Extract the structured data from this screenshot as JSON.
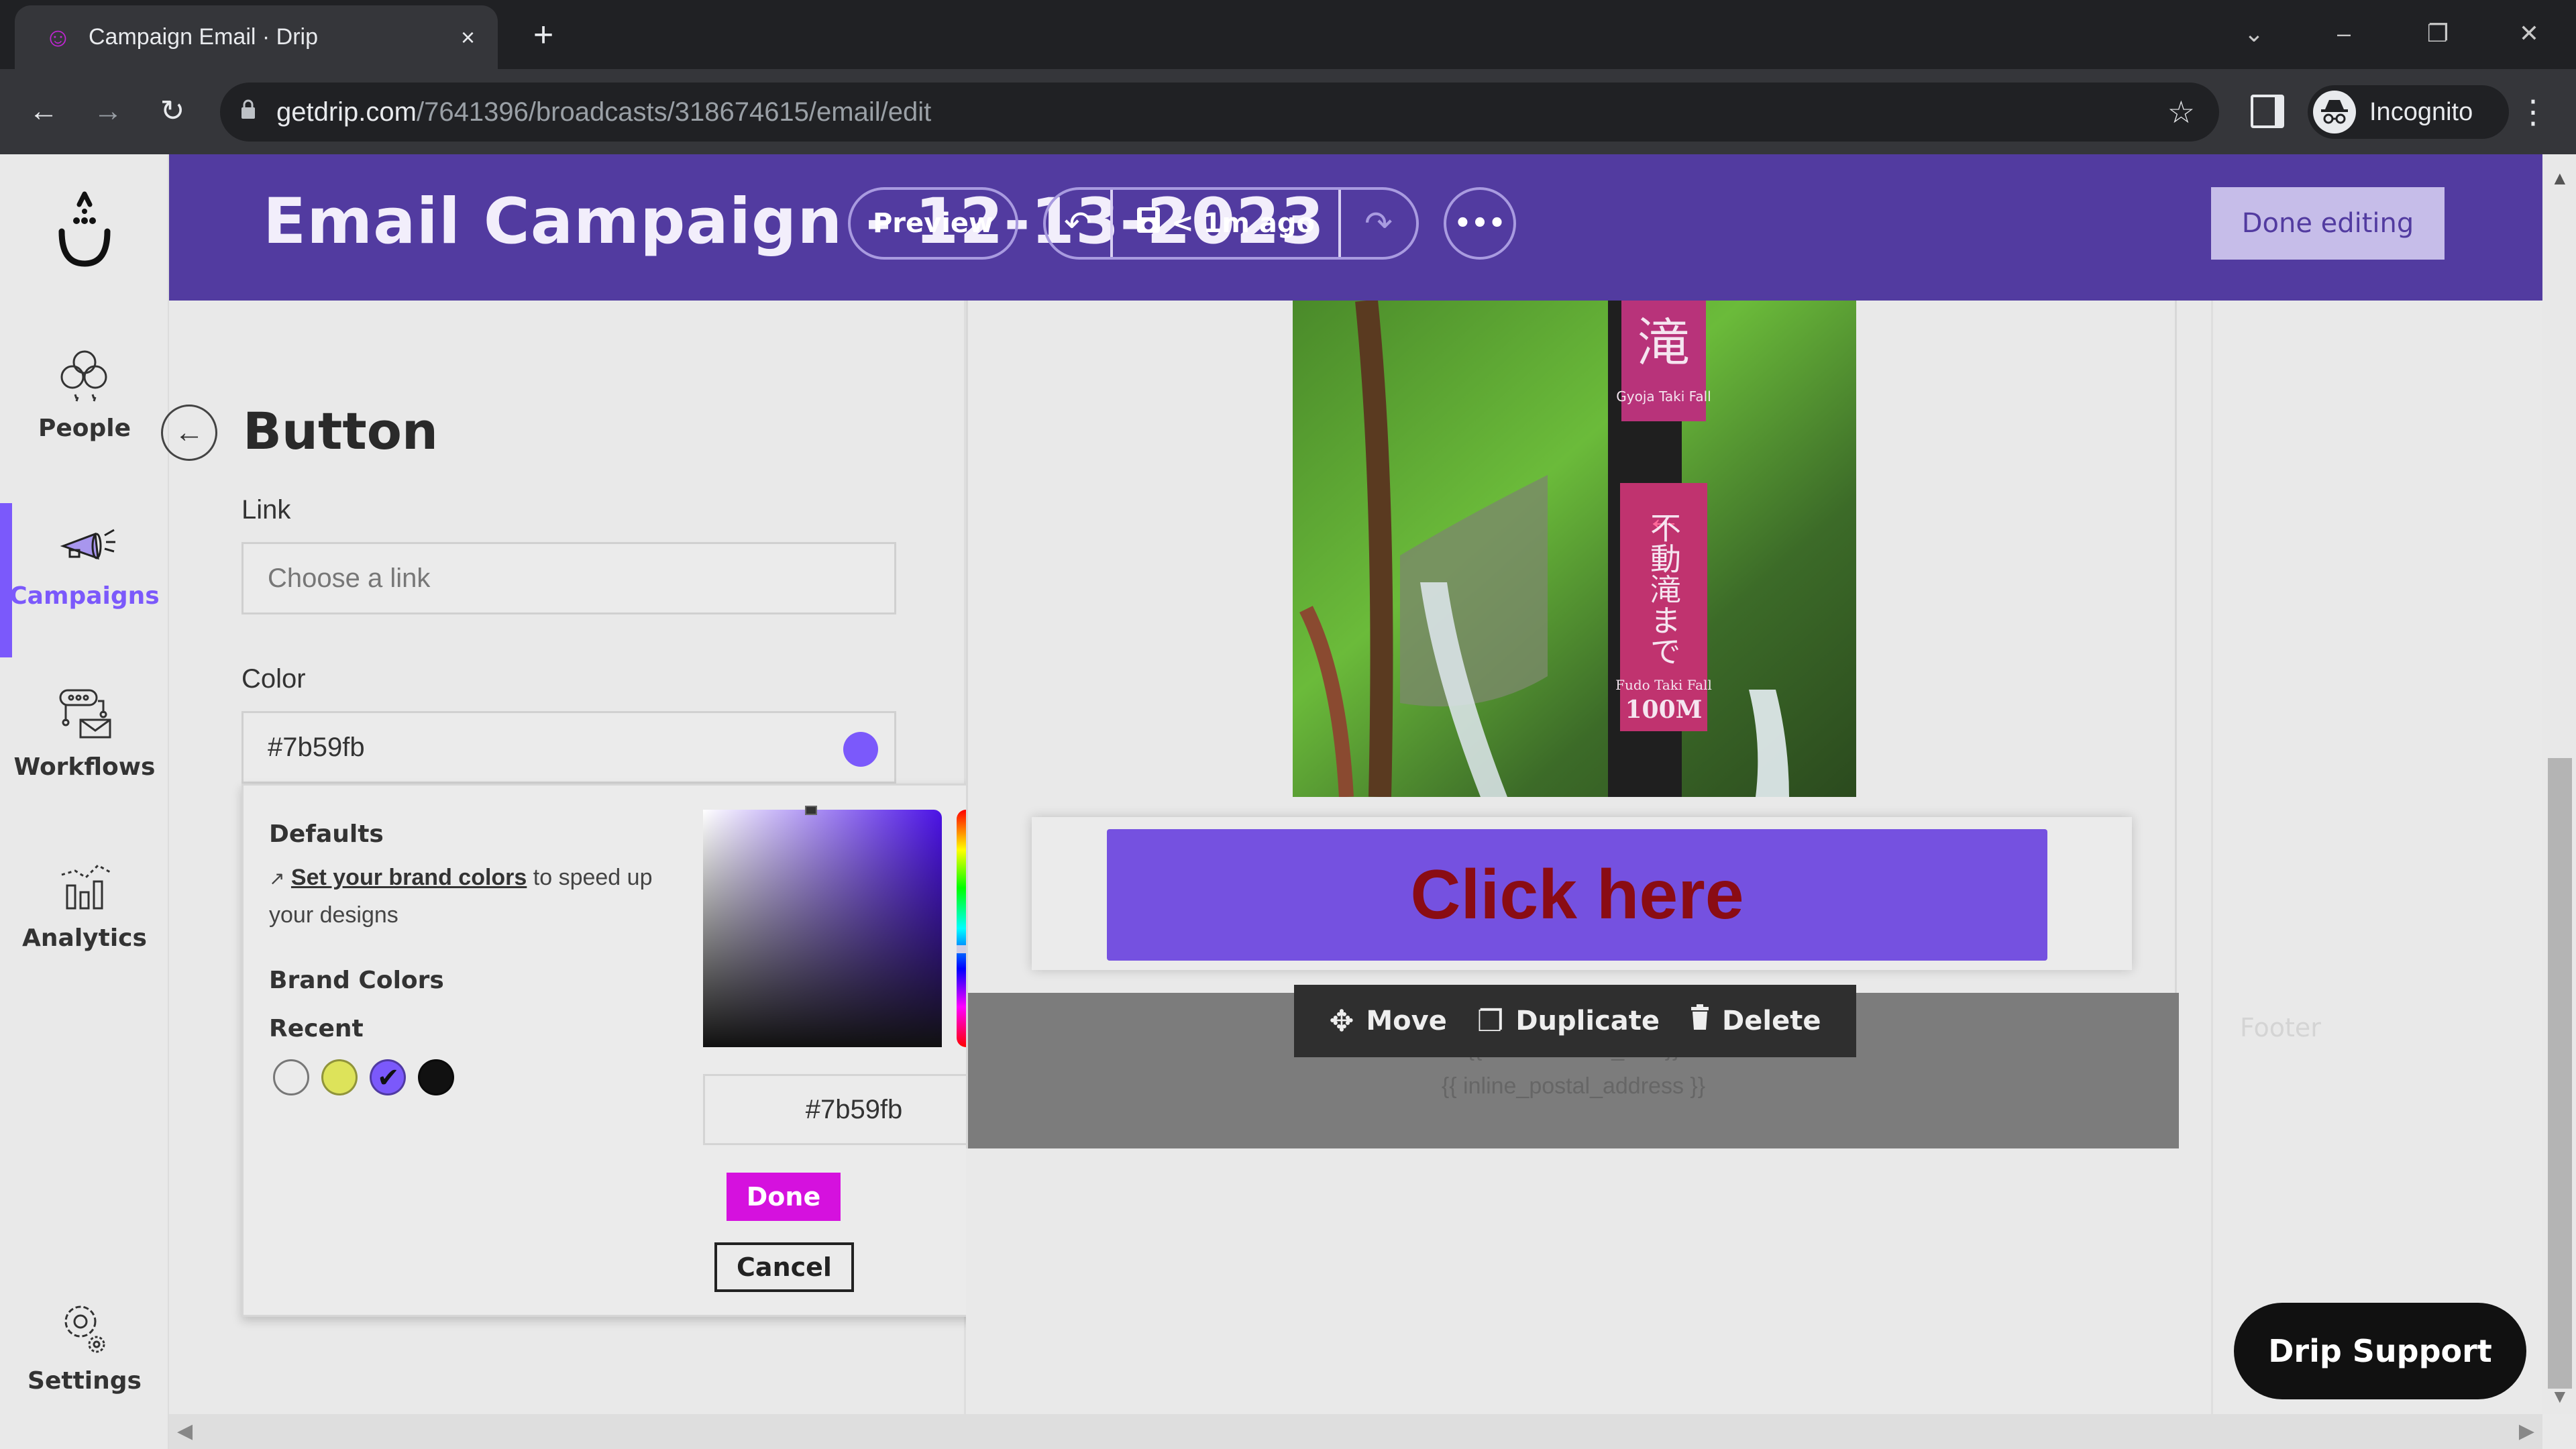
{
  "browser": {
    "tab_title": "Campaign Email · Drip",
    "tab_close": "×",
    "new_tab": "+",
    "url_host": "getdrip.com",
    "url_path": "/7641396/broadcasts/318674615/email/edit",
    "profile_label": "Incognito",
    "icons": {
      "back": "←",
      "forward": "→",
      "reload": "↻",
      "lock": "🔒",
      "star": "☆",
      "menu": "⋮",
      "tab_list": "⌄",
      "minimize": "–",
      "restore": "❐",
      "close": "✕",
      "incognito": "🕶"
    }
  },
  "sidebar": {
    "items": [
      {
        "label": "People",
        "icon": "people-icon",
        "active": false
      },
      {
        "label": "Campaigns",
        "icon": "megaphone-icon",
        "active": true
      },
      {
        "label": "Workflows",
        "icon": "workflow-icon",
        "active": false
      },
      {
        "label": "Analytics",
        "icon": "analytics-icon",
        "active": false
      },
      {
        "label": "Settings",
        "icon": "gear-icon",
        "active": false
      }
    ]
  },
  "header": {
    "title": "Email Campaign - 12-13-2023",
    "preview_label": "Preview",
    "undo_icon": "↶",
    "save_icon": "💾",
    "saved_status": "< 1m ago",
    "redo_icon": "↷",
    "more_icon": "•••",
    "done_editing_label": "Done editing"
  },
  "panel": {
    "back_icon": "←",
    "title": "Button",
    "link_label": "Link",
    "link_placeholder": "Choose a link",
    "link_value": "",
    "color_label": "Color",
    "color_value": "#7b59fb"
  },
  "color_picker": {
    "defaults_heading": "Defaults",
    "external_icon": "↗",
    "brand_link_text": "Set your brand colors",
    "brand_link_suffix": " to speed up your designs",
    "brand_colors_heading": "Brand Colors",
    "recent_heading": "Recent",
    "recent_colors": [
      {
        "hex": "#ebebeb",
        "selected": false
      },
      {
        "hex": "#dde35a",
        "selected": false
      },
      {
        "hex": "#7b59fb",
        "selected": true
      },
      {
        "hex": "#111111",
        "selected": false
      }
    ],
    "hex_value": "#7b59fb",
    "hue_color": "#4b12e6",
    "done_label": "Done",
    "cancel_label": "Cancel"
  },
  "email": {
    "cta_label": "Click here",
    "cta_bg": "#7551e0",
    "cta_text_color": "#8a0c14",
    "unsubscribe_tag": "{{ unsubscribe_link }}",
    "postal_tag": "{{ inline_postal_address }}",
    "image_sign_top": "滝",
    "image_sign_top_en": "Gyoja Taki Fall",
    "image_sign_bottom": "不動滝まで",
    "image_sign_bottom_en": "Fudo Taki Fall",
    "image_sign_distance": "100M",
    "toolbar": {
      "move_label": "Move",
      "duplicate_label": "Duplicate",
      "delete_label": "Delete",
      "move_icon": "✥",
      "duplicate_icon": "❐",
      "delete_icon": "🗑"
    }
  },
  "right_panel": {
    "footer_label": "Footer"
  },
  "support": {
    "label": "Drip Support"
  },
  "colors": {
    "brand_purple": "#523ba0",
    "accent": "#7b59fb",
    "done_magenta": "#d511de"
  }
}
